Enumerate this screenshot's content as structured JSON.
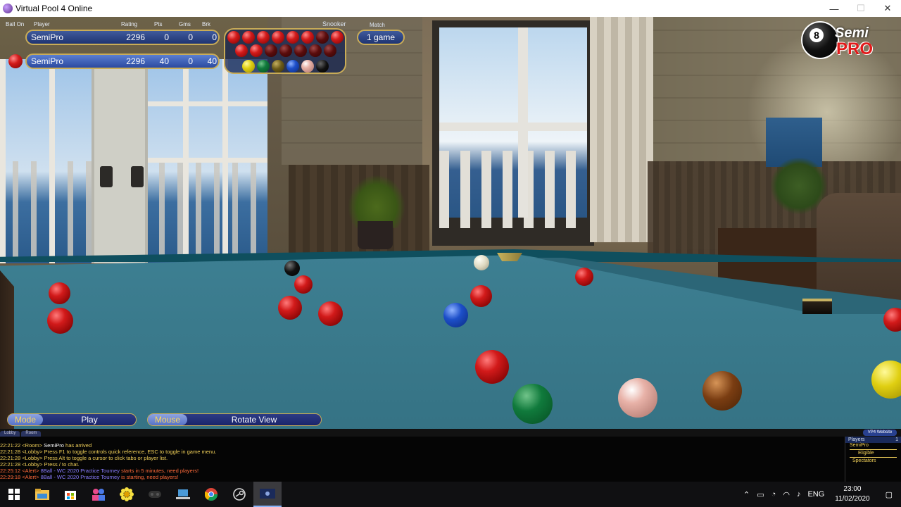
{
  "window": {
    "title": "Virtual Pool 4 Online",
    "minimize": "—",
    "maximize": "☐",
    "close": "✕"
  },
  "scoreboard": {
    "headers": {
      "ball_on": "Ball On",
      "player": "Player",
      "rating": "Rating",
      "pts": "Pts",
      "gms": "Gms",
      "brk": "Brk"
    },
    "rows": [
      {
        "name": "SemiPro",
        "rating": "2296",
        "pts": "0",
        "gms": "0",
        "brk": "0"
      },
      {
        "name": "SemiPro",
        "rating": "2296",
        "pts": "40",
        "gms": "0",
        "brk": "40"
      }
    ],
    "snooker_label": "Snooker",
    "match_label": "Match",
    "match_value": "1 game"
  },
  "logo": {
    "line1": "Semi",
    "line2": "PRO",
    "ball_number": "8"
  },
  "controls": {
    "mode_label": "Mode",
    "mode_value": "Play",
    "mouse_label": "Mouse",
    "mouse_value": "Rotate View"
  },
  "tabs": [
    "Lobby",
    "Room"
  ],
  "vp4_website": "VP4 Website",
  "chat": [
    {
      "ts": "22:21:22",
      "room": "<Room>",
      "who": "SemiPro",
      "text": " has arrived",
      "type": "room"
    },
    {
      "ts": "22:21:28",
      "room": "<Lobby>",
      "who": "",
      "text": " Press F1 to toggle controls quick reference, ESC to toggle in game menu.",
      "type": "lobby"
    },
    {
      "ts": "22:21:28",
      "room": "<Lobby>",
      "who": "",
      "text": " Press Alt to toggle a cursor to click tabs or player list.",
      "type": "lobby"
    },
    {
      "ts": "22:21:28",
      "room": "<Lobby>",
      "who": "",
      "text": " Press / to chat.",
      "type": "lobby"
    },
    {
      "ts": "22:25:12",
      "room": "<Alert>",
      "who": "",
      "event": " 8Ball - WC 2020 Practice Tourney",
      "text": " starts in 5 minutes, need players!",
      "type": "alert"
    },
    {
      "ts": "22:29:18",
      "room": "<Alert>",
      "who": "",
      "event": " 8Ball - WC 2020 Practice Tourney",
      "text": " is starting, need players!",
      "type": "alert"
    }
  ],
  "players_panel": {
    "header": "Players",
    "count": "1",
    "list": [
      "SemiPro",
      "Eligible",
      "Spectators"
    ]
  },
  "taskbar": {
    "tray_lang": "ENG",
    "time": "23:00",
    "date": "11/02/2020"
  },
  "colors": {
    "accent": "#c9ac57",
    "hud_blue": "#1f3472",
    "cloth": "#3a7a8c",
    "chat_yellow": "#f3d25a",
    "alert_orange": "#ff6a3a"
  },
  "icons": [
    "windows-start-icon",
    "file-explorer-icon",
    "store-icon",
    "people-icon",
    "flower-icon",
    "gamepad-icon",
    "laptop-icon",
    "chrome-icon",
    "steam-icon",
    "virtual-pool-icon"
  ]
}
